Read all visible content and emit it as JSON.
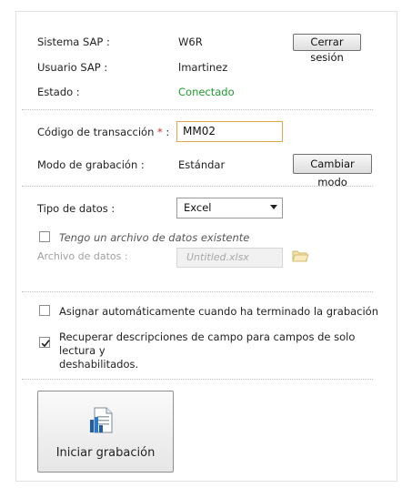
{
  "session": {
    "system_label": "Sistema SAP :",
    "system_value": "W6R",
    "logout_label": "Cerrar sesión",
    "user_label": "Usuario SAP :",
    "user_value": "lmartinez",
    "status_label": "Estado :",
    "status_value": "Conectado",
    "status_color": "#1f9a2e"
  },
  "transaction": {
    "code_label": "Código de transacción",
    "required_mark": "*",
    "code_colon": " :",
    "code_value": "MM02",
    "mode_label": "Modo de grabación :",
    "mode_value": "Estándar",
    "change_mode_label": "Cambiar modo"
  },
  "data": {
    "type_label": "Tipo de datos :",
    "type_selected": "Excel",
    "has_file_label": "Tengo un archivo de datos existente",
    "has_file_checked": false,
    "file_label": "Archivo de datos :",
    "file_placeholder": "Untitled.xlsx",
    "folder_icon": "folder-open-icon"
  },
  "options": {
    "auto_assign_label": "Asignar automáticamente cuando ha terminado la grabación",
    "auto_assign_checked": false,
    "retrieve_desc_label_line1": "Recuperar descripciones de campo para campos de solo lectura y",
    "retrieve_desc_label_line2": "deshabilitados.",
    "retrieve_desc_checked": true
  },
  "action": {
    "start_label": "Iniciar grabación",
    "icon": "record-document-icon",
    "accent": "#1e5fa8"
  }
}
